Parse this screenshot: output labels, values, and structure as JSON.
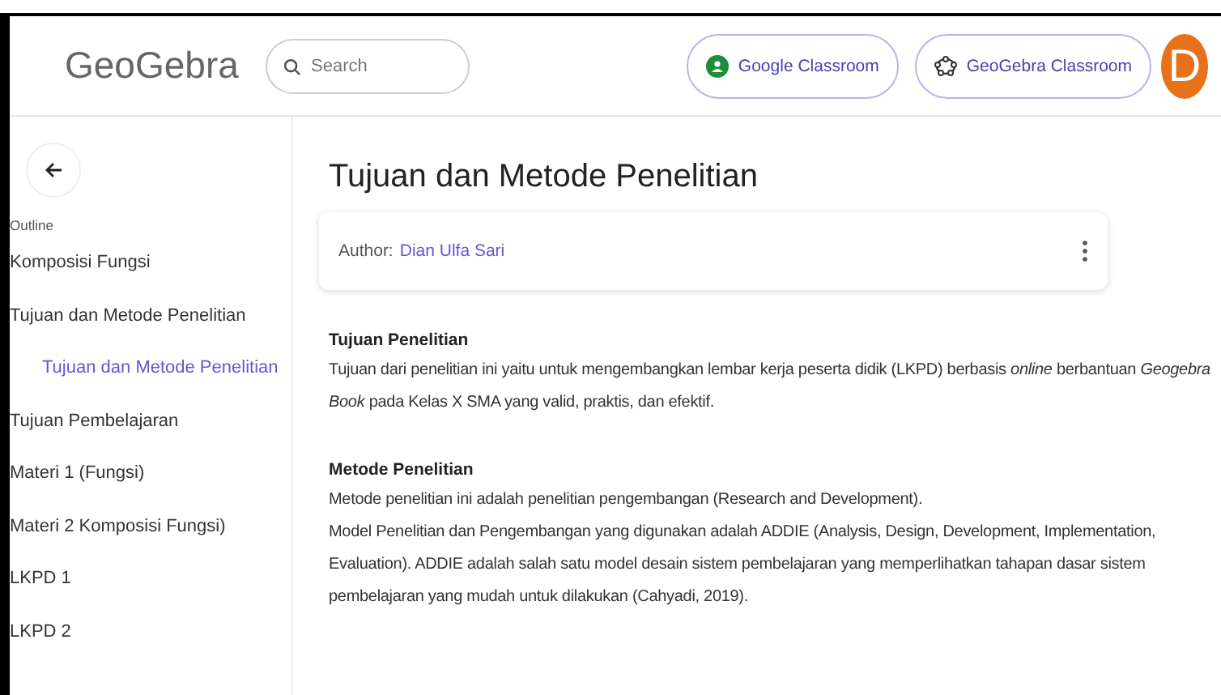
{
  "header": {
    "logo": "GeoGebra",
    "search": {
      "placeholder": "Search"
    },
    "buttons": [
      {
        "label": "Google Classroom",
        "kind": "google"
      },
      {
        "label": "GeoGebra Classroom",
        "kind": "geogebra"
      }
    ],
    "avatar": "D"
  },
  "sidebar": {
    "heading": "Outline",
    "items": [
      {
        "label": "Komposisi Fungsi",
        "selected": false
      },
      {
        "label": "Tujuan dan Metode Penelitian",
        "selected": false,
        "children": [
          {
            "label": "Tujuan dan Metode Penelitian",
            "selected": true
          }
        ]
      },
      {
        "label": "Tujuan Pembelajaran",
        "selected": false
      },
      {
        "label": "Materi 1 (Fungsi)",
        "selected": false
      },
      {
        "label": "Materi 2 Komposisi Fungsi)",
        "selected": false
      },
      {
        "label": "LKPD 1",
        "selected": false
      },
      {
        "label": "LKPD 2",
        "selected": false
      }
    ]
  },
  "page": {
    "title": "Tujuan dan Metode Penelitian",
    "author_label": "Author:",
    "author": "Dian Ulfa Sari",
    "sections": [
      {
        "heading": "Tujuan Penelitian",
        "paragraphs": [
          "Tujuan dari penelitian ini yaitu untuk mengembangkan lembar kerja peserta didik (LKPD) berbasis *online* berbantuan *Geogebra Book* pada Kelas X SMA yang valid, praktis, dan efektif."
        ]
      },
      {
        "heading": "Metode Penelitian",
        "paragraphs": [
          "Metode penelitian ini adalah penelitian pengembangan (Research and Development).",
          "Model Penelitian dan Pengembangan yang digunakan adalah ADDIE (Analysis, Design, Development, Implementation, Evaluation). ADDIE adalah salah satu model desain sistem pembelajaran yang memperlihatkan tahapan dasar sistem pembelajaran yang mudah untuk dilakukan (Cahyadi, 2019)."
        ]
      }
    ]
  }
}
